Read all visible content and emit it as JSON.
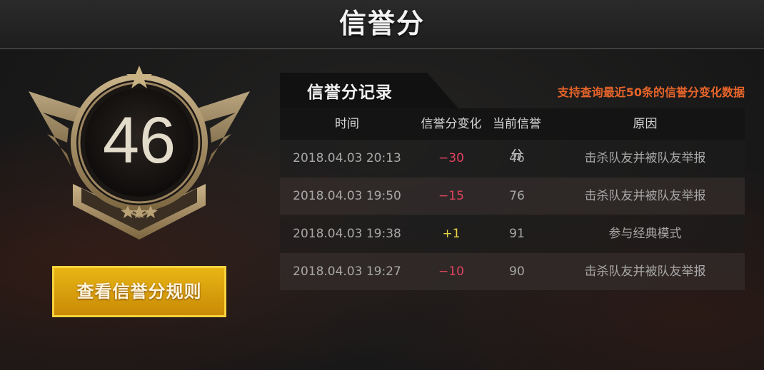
{
  "header": {
    "title": "信誉分"
  },
  "badge": {
    "score": "46"
  },
  "rules_button": {
    "label": "查看信誉分规则"
  },
  "records": {
    "title": "信誉分记录",
    "notice": "支持查询最近50条的信誉分变化数据",
    "columns": [
      "时间",
      "信誉分变化",
      "当前信誉分",
      "原因"
    ],
    "rows": [
      {
        "time": "2018.04.03 20:13",
        "change": "−30",
        "current": "46",
        "reason": "击杀队友并被队友举报"
      },
      {
        "time": "2018.04.03 19:50",
        "change": "−15",
        "current": "76",
        "reason": "击杀队友并被队友举报"
      },
      {
        "time": "2018.04.03 19:38",
        "change": "+1",
        "current": "91",
        "reason": "参与经典模式"
      },
      {
        "time": "2018.04.03 19:27",
        "change": "−10",
        "current": "90",
        "reason": "击杀队友并被队友举报"
      }
    ]
  },
  "colors": {
    "accent_gold": "#e8b514",
    "notice_orange": "#e8652a",
    "negative": "#e1435f",
    "positive": "#e9d148"
  }
}
